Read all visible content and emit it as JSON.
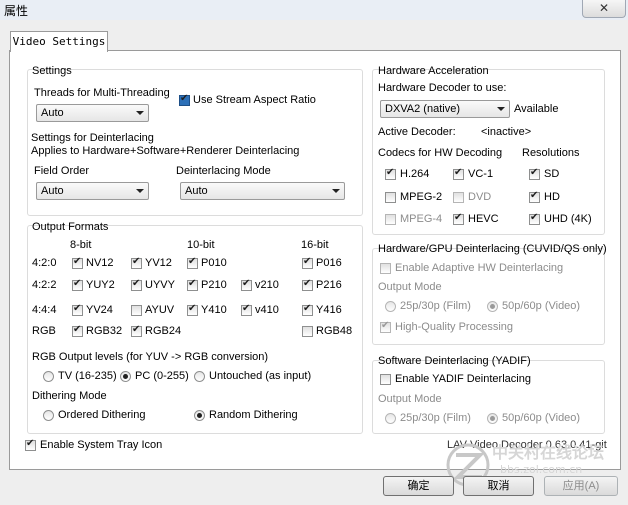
{
  "window": {
    "title": "属性",
    "close": "✕"
  },
  "tab": "Video Settings",
  "settings": {
    "legend": "Settings",
    "threads_label": "Threads for Multi-Threading",
    "threads_value": "Auto",
    "aspect_label": "Use Stream Aspect Ratio",
    "aspect_checked": true,
    "deint_heading_1": "Settings for Deinterlacing",
    "deint_heading_2": "Applies to Hardware+Software+Renderer Deinterlacing",
    "field_order_label": "Field Order",
    "field_order_value": "Auto",
    "deint_mode_label": "Deinterlacing Mode",
    "deint_mode_value": "Auto"
  },
  "output_formats": {
    "legend": "Output Formats",
    "col_8bit": "8-bit",
    "col_10bit": "10-bit",
    "col_16bit": "16-bit",
    "rows": [
      {
        "label": "4:2:0",
        "items": [
          {
            "name": "NV12",
            "checked": true
          },
          {
            "name": "YV12",
            "checked": true
          },
          {
            "name": "P010",
            "checked": true
          },
          {
            "name": "P016",
            "checked": true
          }
        ]
      },
      {
        "label": "4:2:2",
        "items": [
          {
            "name": "YUY2",
            "checked": true
          },
          {
            "name": "UYVY",
            "checked": true
          },
          {
            "name": "P210",
            "checked": true
          },
          {
            "name": "v210",
            "checked": true
          },
          {
            "name": "P216",
            "checked": true
          }
        ]
      },
      {
        "label": "4:4:4",
        "items": [
          {
            "name": "YV24",
            "checked": true
          },
          {
            "name": "AYUV",
            "checked": false
          },
          {
            "name": "Y410",
            "checked": true
          },
          {
            "name": "v410",
            "checked": true
          },
          {
            "name": "Y416",
            "checked": true
          }
        ]
      },
      {
        "label": "RGB",
        "items": [
          {
            "name": "RGB32",
            "checked": true
          },
          {
            "name": "RGB24",
            "checked": true
          },
          {
            "name": "RGB48",
            "checked": false
          }
        ]
      }
    ],
    "rgb_levels_label": "RGB Output levels (for YUV -> RGB conversion)",
    "rgb_levels": [
      {
        "label": "TV (16-235)",
        "selected": false
      },
      {
        "label": "PC (0-255)",
        "selected": true
      },
      {
        "label": "Untouched (as input)",
        "selected": false
      }
    ],
    "dither_label": "Dithering Mode",
    "dither": [
      {
        "label": "Ordered Dithering",
        "selected": false
      },
      {
        "label": "Random Dithering",
        "selected": true
      }
    ]
  },
  "system_tray": {
    "label": "Enable System Tray Icon",
    "checked": true
  },
  "hw_accel": {
    "legend": "Hardware Acceleration",
    "decoder_label": "Hardware Decoder to use:",
    "decoder_value": "DXVA2 (native)",
    "available": "Available",
    "active_label": "Active Decoder:",
    "active_value": "<inactive>",
    "codecs_label": "Codecs for HW Decoding",
    "resolutions_label": "Resolutions",
    "codecs": [
      {
        "name": "H.264",
        "checked": true,
        "enabled": true
      },
      {
        "name": "VC-1",
        "checked": true,
        "enabled": true
      },
      {
        "name": "MPEG-2",
        "checked": false,
        "enabled": true
      },
      {
        "name": "DVD",
        "checked": false,
        "enabled": false
      },
      {
        "name": "MPEG-4",
        "checked": false,
        "enabled": false
      },
      {
        "name": "HEVC",
        "checked": true,
        "enabled": true
      }
    ],
    "resolutions": [
      {
        "name": "SD",
        "checked": true
      },
      {
        "name": "HD",
        "checked": true
      },
      {
        "name": "UHD (4K)",
        "checked": true
      }
    ]
  },
  "hw_deint": {
    "legend": "Hardware/GPU Deinterlacing (CUVID/QS only)",
    "adaptive_label": "Enable Adaptive HW Deinterlacing",
    "output_mode_label": "Output Mode",
    "film": "25p/30p (Film)",
    "video": "50p/60p (Video)",
    "hq_label": "High-Quality Processing"
  },
  "sw_deint": {
    "legend": "Software Deinterlacing (YADIF)",
    "yadif_label": "Enable YADIF Deinterlacing",
    "output_mode_label": "Output Mode",
    "film": "25p/30p (Film)",
    "video": "50p/60p (Video)"
  },
  "version": "LAV Video Decoder 0.63.0.41-git",
  "watermark": {
    "text": "中关村在线论坛",
    "url": "bbs.zol.com.cn"
  },
  "buttons": {
    "ok": "确定",
    "cancel": "取消",
    "apply": "应用(A)"
  },
  "colors": {
    "accent": "#2c70b8",
    "disabled_text": "#8c8c8c"
  }
}
